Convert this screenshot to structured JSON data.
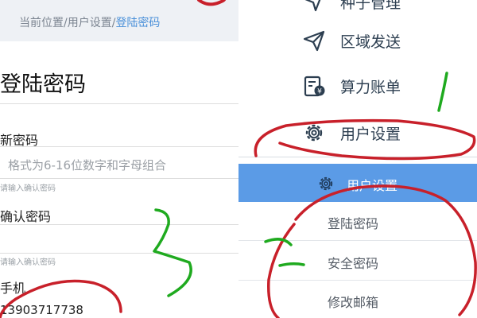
{
  "breadcrumb": {
    "prefix": "当前位置/用户设置/",
    "current": "登陆密码"
  },
  "form": {
    "title": "登陆密码",
    "new_password_label": "新密码",
    "new_password_placeholder": "格式为6-16位数字和字母组合",
    "confirm_hint_1": "请输入确认密码",
    "confirm_password_label": "确认密码",
    "confirm_hint_2": "请输入确认密码",
    "phone_label": "手机",
    "phone_value": "13903717738"
  },
  "menu": {
    "items": [
      {
        "label": "种子管理",
        "icon": "send-icon"
      },
      {
        "label": "区域发送",
        "icon": "paper-plane-icon"
      },
      {
        "label": "算力账单",
        "icon": "bill-icon"
      },
      {
        "label": "用户设置",
        "icon": "gear-icon"
      }
    ],
    "active_group": {
      "label": "用户设置",
      "icon": "gear-icon"
    },
    "sub_items": [
      {
        "label": "登陆密码"
      },
      {
        "label": "安全密码"
      },
      {
        "label": "修改邮箱"
      }
    ]
  },
  "colors": {
    "accent": "#5b9be6",
    "breadcrumb_active": "#4a90d9",
    "menu_text": "#2c3e50",
    "annotation_red": "#c8202a",
    "annotation_green": "#1faa1f"
  }
}
